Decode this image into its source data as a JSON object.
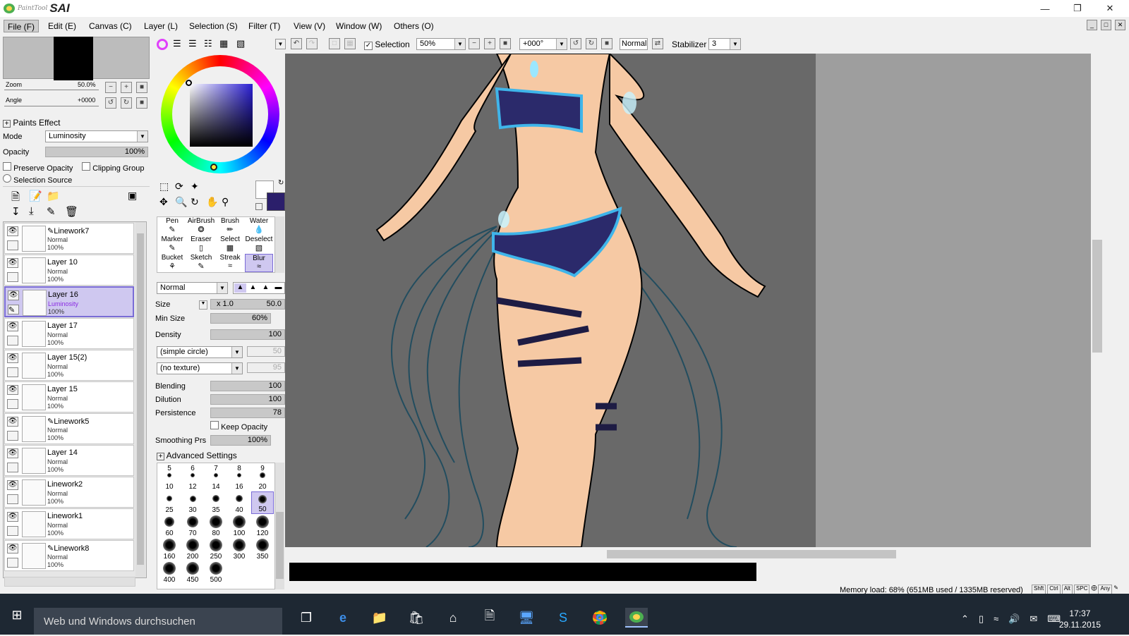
{
  "app": {
    "brand_small": "PaintTool",
    "brand": "SAI"
  },
  "menu": [
    "File (F)",
    "Edit (E)",
    "Canvas (C)",
    "Layer (L)",
    "Selection (S)",
    "Filter (T)",
    "View (V)",
    "Window (W)",
    "Others (O)"
  ],
  "navigator": {
    "zoom_label": "Zoom",
    "zoom_value": "50.0%",
    "angle_label": "Angle",
    "angle_value": "+0000"
  },
  "paints_effect": {
    "title": "Paints Effect",
    "mode_label": "Mode",
    "mode_value": "Luminosity",
    "opacity_label": "Opacity",
    "opacity_value": "100%",
    "preserve_opacity": "Preserve Opacity",
    "clipping_group": "Clipping Group",
    "selection_source": "Selection Source"
  },
  "layers": [
    {
      "name": "Linework7",
      "mode": "Normal",
      "opacity": "100%",
      "pen": true
    },
    {
      "name": "Layer 10",
      "mode": "Normal",
      "opacity": "100%"
    },
    {
      "name": "Layer 16",
      "mode": "Luminosity",
      "opacity": "100%",
      "selected": true
    },
    {
      "name": "Layer 17",
      "mode": "Normal",
      "opacity": "100%"
    },
    {
      "name": "Layer 15(2)",
      "mode": "Normal",
      "opacity": "100%"
    },
    {
      "name": "Layer 15",
      "mode": "Normal",
      "opacity": "100%"
    },
    {
      "name": "Linework5",
      "mode": "Normal",
      "opacity": "100%",
      "pen": true
    },
    {
      "name": "Layer 14",
      "mode": "Normal",
      "opacity": "100%"
    },
    {
      "name": "Linework2",
      "mode": "Normal",
      "opacity": "100%"
    },
    {
      "name": "Linework1",
      "mode": "Normal",
      "opacity": "100%"
    },
    {
      "name": "Linework8",
      "mode": "Normal",
      "opacity": "100%",
      "pen": true
    }
  ],
  "tools": [
    "Pen",
    "AirBrush",
    "Brush",
    "Water",
    "Marker",
    "Eraser",
    "Select",
    "Deselect",
    "Bucket",
    "Sketch",
    "Streak",
    "Blur"
  ],
  "brush": {
    "blend_mode": "Normal",
    "size_label": "Size",
    "size_mult": "x 1.0",
    "size_value": "50.0",
    "minsize_label": "Min Size",
    "minsize_value": "60%",
    "density_label": "Density",
    "density_value": "100",
    "shape": "(simple circle)",
    "shape_val": "50",
    "texture": "(no texture)",
    "texture_val": "95",
    "blending_label": "Blending",
    "blending_value": "100",
    "dilution_label": "Dilution",
    "dilution_value": "100",
    "persistence_label": "Persistence",
    "persistence_value": "78",
    "keep_opacity": "Keep Opacity",
    "smoothing_label": "Smoothing Prs",
    "smoothing_value": "100%",
    "advanced": "Advanced Settings"
  },
  "brush_sizes": [
    "5",
    "6",
    "7",
    "8",
    "9",
    "10",
    "12",
    "14",
    "16",
    "20",
    "25",
    "30",
    "35",
    "40",
    "50",
    "60",
    "70",
    "80",
    "100",
    "120",
    "160",
    "200",
    "250",
    "300",
    "350",
    "400",
    "450",
    "500"
  ],
  "toolbar": {
    "selection_label": "Selection",
    "zoom": "50%",
    "rotation": "+000°",
    "mode": "Normal",
    "stabilizer_label": "Stabilizer",
    "stabilizer_value": "3"
  },
  "status": {
    "memory": "Memory load: 68% (651MB used / 1335MB reserved)",
    "keys": [
      "Shft",
      "Ctrl",
      "Alt",
      "SPC",
      "Any"
    ]
  },
  "taskbar": {
    "search": "Web und Windows durchsuchen",
    "time": "17:37",
    "date": "29.11.2015"
  },
  "colors": {
    "taskbar": "#1e2833",
    "canvas_bg": "#696969",
    "skin": "#f6c9a4",
    "outfit": "#2b2a6b",
    "accent": "#3fb5ea"
  }
}
